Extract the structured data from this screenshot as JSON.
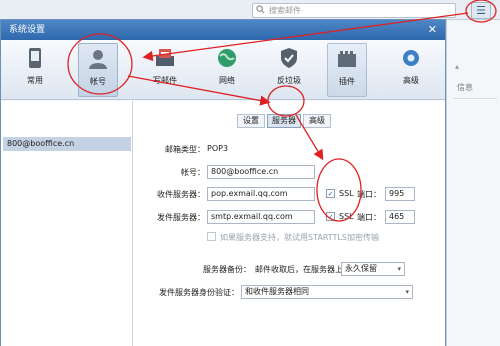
{
  "app": {
    "search_placeholder": "搜索邮件",
    "side_info": "信息",
    "menu_icon": "list-icon"
  },
  "dialog": {
    "title": "系统设置",
    "close_icon": "close-icon"
  },
  "toolbar": {
    "items": [
      {
        "label": "常用",
        "icon": "phone-icon"
      },
      {
        "label": "帐号",
        "icon": "user-icon"
      },
      {
        "label": "写邮件",
        "icon": "compose-icon"
      },
      {
        "label": "网络",
        "icon": "globe-icon"
      },
      {
        "label": "反垃圾",
        "icon": "shield-icon"
      },
      {
        "label": "插件",
        "icon": "plugin-icon"
      },
      {
        "label": "高级",
        "icon": "gear-icon"
      }
    ]
  },
  "accounts": {
    "items": [
      "800@booffice.cn"
    ]
  },
  "tabs": {
    "items": [
      "设置",
      "服务器",
      "高级"
    ],
    "active": "服务器"
  },
  "server": {
    "mail_type_label": "邮箱类型：",
    "mail_type_value": "POP3",
    "account_label": "帐号：",
    "account_value": "800@booffice.cn",
    "incoming_label": "收件服务器：",
    "incoming_value": "pop.exmail.qq.com",
    "incoming_ssl_label": "SSL",
    "incoming_ssl_checked": true,
    "incoming_port_label": "端口：",
    "incoming_port_value": "995",
    "outgoing_label": "发件服务器：",
    "outgoing_value": "smtp.exmail.qq.com",
    "outgoing_ssl_label": "SSL",
    "outgoing_ssl_checked": true,
    "outgoing_port_label": "端口：",
    "outgoing_port_value": "465",
    "starttls_label": "如果服务器支持，就试用STARTTLS加密传输",
    "starttls_checked": false,
    "backup_label": "服务器备份：",
    "backup_text": "邮件收取后，在服务器上",
    "backup_value": "永久保留",
    "auth_label": "发件服务器身份验证：",
    "auth_value": "和收件服务器相同"
  },
  "colors": {
    "annotation": "#e02020",
    "title_bar": "#3a74b8",
    "selected_row": "#c4d2e4"
  }
}
